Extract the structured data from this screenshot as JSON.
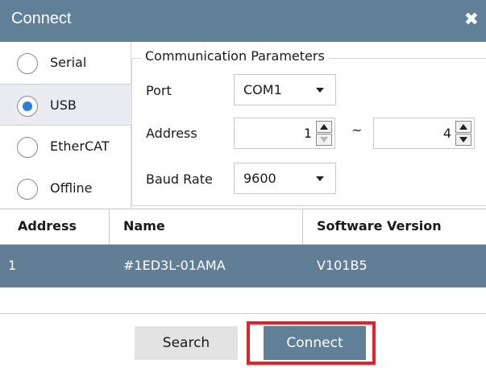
{
  "window": {
    "title": "Connect",
    "close_symbol": "✖"
  },
  "connection_types": [
    {
      "label": "Serial",
      "selected": false
    },
    {
      "label": "USB",
      "selected": true
    },
    {
      "label": "EtherCAT",
      "selected": false
    },
    {
      "label": "Offline",
      "selected": false
    }
  ],
  "params": {
    "legend": "Communication Parameters",
    "port_label": "Port",
    "port_value": "COM1",
    "address_label": "Address",
    "address_from": "1",
    "address_sep": "~",
    "address_to": "4",
    "baud_label": "Baud Rate",
    "baud_value": "9600"
  },
  "table": {
    "headers": [
      "Address",
      "Name",
      "Software Version"
    ],
    "rows": [
      {
        "address": "1",
        "name": "#1ED3L-01AMA",
        "software_version": "V101B5"
      }
    ]
  },
  "buttons": {
    "search": "Search",
    "connect": "Connect"
  },
  "colors": {
    "title_bar": "#5f8096",
    "selected_row": "#617e95",
    "radio_selected": "#2f7fd8",
    "highlight_box": "#e6202a"
  },
  "icons": {
    "close": "close-icon",
    "dropdown": "chevron-down-icon",
    "spin_up": "spin-up-icon",
    "spin_down": "spin-down-icon"
  }
}
